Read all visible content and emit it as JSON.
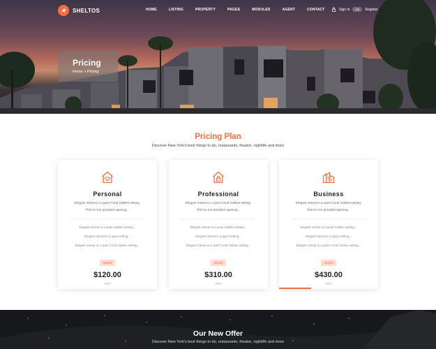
{
  "brand": {
    "name": "SHELTOS",
    "accent": "#f36f43"
  },
  "nav": {
    "items": [
      "HOME",
      "LISTING",
      "PROPERTY",
      "PAGES",
      "MODULES",
      "AGENT",
      "CONTACT"
    ],
    "signin": "Sign in",
    "or": "OR",
    "register": "Register"
  },
  "hero": {
    "title": "Pricing",
    "breadcrumb": "Home  »  Pricing"
  },
  "pricing": {
    "title": "Pricing Plan",
    "subtitle": "Discover New York's best things to do, restaurants, theatre, nightlife and more",
    "plans": [
      {
        "name": "Personal",
        "icon": "home-heart-icon",
        "desc": "Elegant retreat in a quiet Coral Gables setting. This ho me provides opening...",
        "features": [
          "Elegant retreat in a quiet Gables setting...",
          "Elegant retreat in a quiet setting...",
          "Elegant retreat in a quiet Coral Gables setting..."
        ],
        "badge": "Month",
        "price": "$120.00",
        "per": "PER"
      },
      {
        "name": "Professional",
        "icon": "home-lock-icon",
        "desc": "Elegant retreat in a quiet Coral Gables setting. This ho me provides opening...",
        "features": [
          "Elegant retreat in a quiet Gables setting...",
          "Elegant retreat in a quiet setting...",
          "Elegant retreat in a quiet Coral Gables setting..."
        ],
        "badge": "Month",
        "price": "$310.00",
        "per": "PER"
      },
      {
        "name": "Business",
        "icon": "buildings-icon",
        "desc": "Elegant retreat in a quiet Coral Gables setting. This ho me provides opening...",
        "features": [
          "Elegant retreat in a quiet Gables setting...",
          "Elegant retreat in a quiet setting...",
          "Elegant retreat in a quiet Coral Gables setting..."
        ],
        "badge": "Month",
        "price": "$430.00",
        "per": "PER"
      }
    ]
  },
  "offer": {
    "title": "Our New Offer",
    "subtitle": "Discover New York's best things to do, restaurants, theatre, nightlife and more"
  }
}
